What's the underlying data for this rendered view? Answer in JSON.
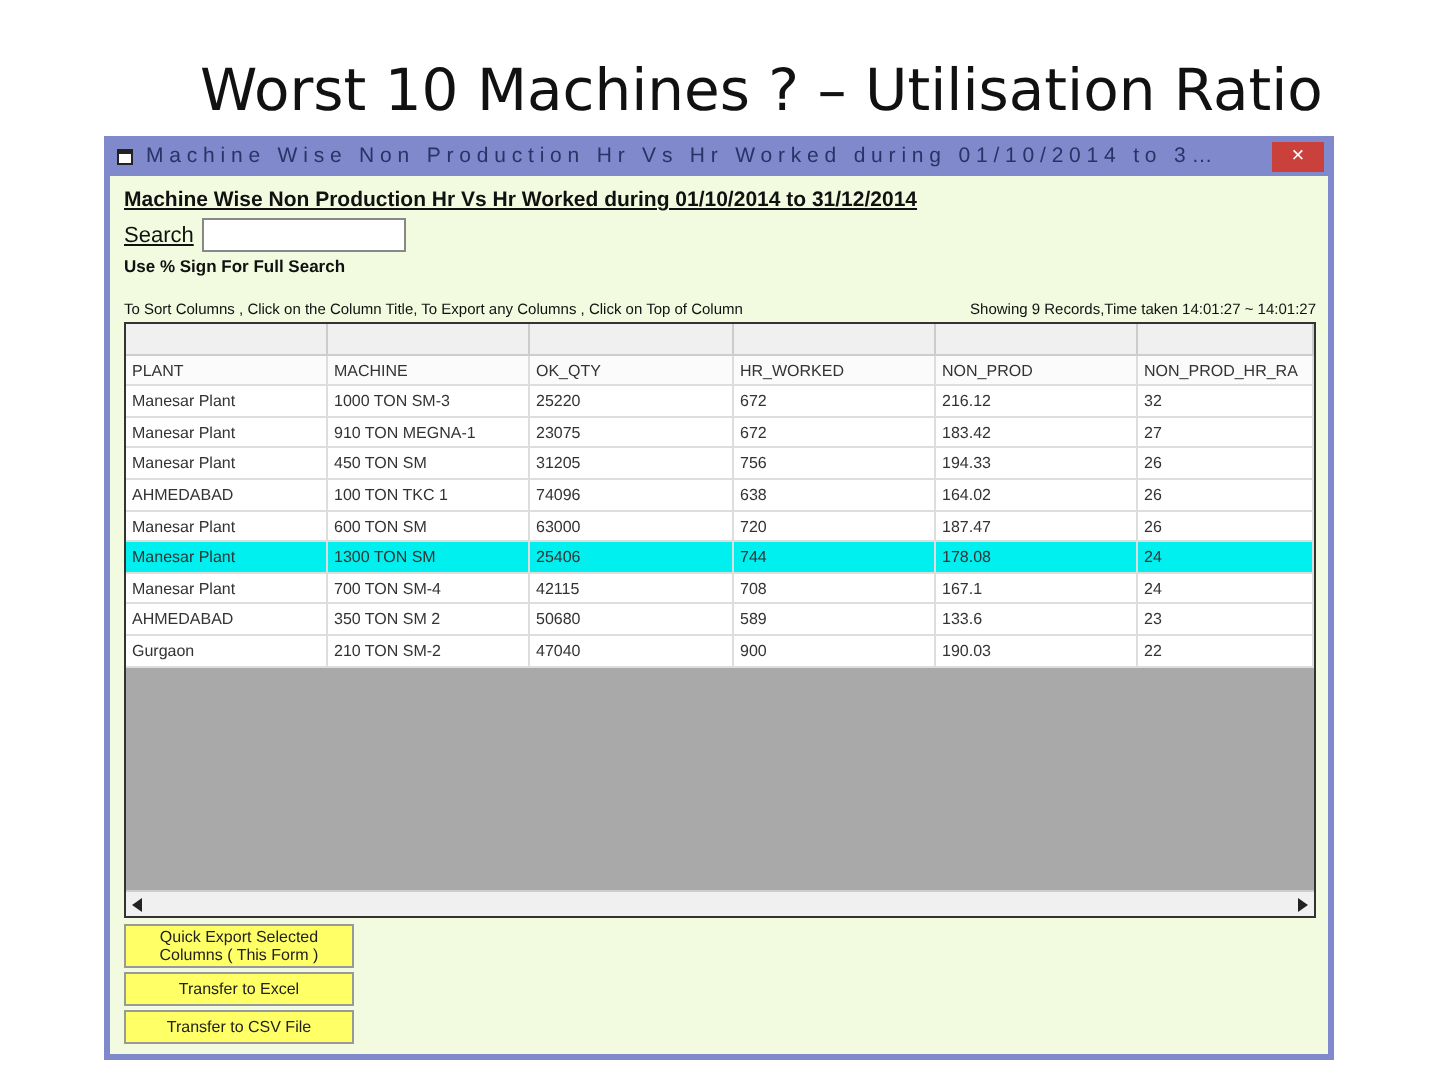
{
  "slide_title": "Worst 10 Machines ? – Utilisation Ratio",
  "window": {
    "title": "Machine Wise Non Production Hr Vs Hr Worked during 01/10/2014 to 3…",
    "close": "×"
  },
  "report_title": "Machine Wise Non Production Hr Vs Hr Worked during 01/10/2014 to 31/12/2014",
  "search": {
    "label": "Search"
  },
  "search_hint": "Use % Sign For Full Search",
  "sort_hint": "To Sort Columns , Click on the Column Title, To Export any Columns , Click on Top of Column",
  "status": "Showing 9 Records,Time taken 14:01:27 ~ 14:01:27",
  "table": {
    "columns": [
      "PLANT",
      "MACHINE",
      "OK_QTY",
      "HR_WORKED",
      "NON_PROD",
      "NON_PROD_HR_RA"
    ],
    "rows": [
      {
        "cells": [
          "Manesar Plant",
          "1000 TON SM-3",
          "25220",
          "672",
          "216.12",
          "32"
        ],
        "selected": false
      },
      {
        "cells": [
          "Manesar Plant",
          "910 TON MEGNA-1",
          "23075",
          "672",
          "183.42",
          "27"
        ],
        "selected": false
      },
      {
        "cells": [
          "Manesar Plant",
          "450 TON SM",
          "31205",
          "756",
          "194.33",
          "26"
        ],
        "selected": false
      },
      {
        "cells": [
          "AHMEDABAD",
          "100 TON TKC 1",
          "74096",
          "638",
          "164.02",
          "26"
        ],
        "selected": false
      },
      {
        "cells": [
          "Manesar Plant",
          "600 TON SM",
          "63000",
          "720",
          "187.47",
          "26"
        ],
        "selected": false
      },
      {
        "cells": [
          "Manesar Plant",
          "1300 TON SM",
          "25406",
          "744",
          "178.08",
          "24"
        ],
        "selected": true
      },
      {
        "cells": [
          "Manesar Plant",
          "700 TON SM-4",
          "42115",
          "708",
          "167.1",
          "24"
        ],
        "selected": false
      },
      {
        "cells": [
          "AHMEDABAD",
          "350 TON SM 2",
          "50680",
          "589",
          "133.6",
          "23"
        ],
        "selected": false
      },
      {
        "cells": [
          "Gurgaon",
          "210 TON SM-2",
          "47040",
          "900",
          "190.03",
          "22"
        ],
        "selected": false
      }
    ]
  },
  "buttons": [
    "Quick Export Selected Columns ( This Form )",
    "Transfer to Excel",
    "Transfer to CSV File"
  ]
}
